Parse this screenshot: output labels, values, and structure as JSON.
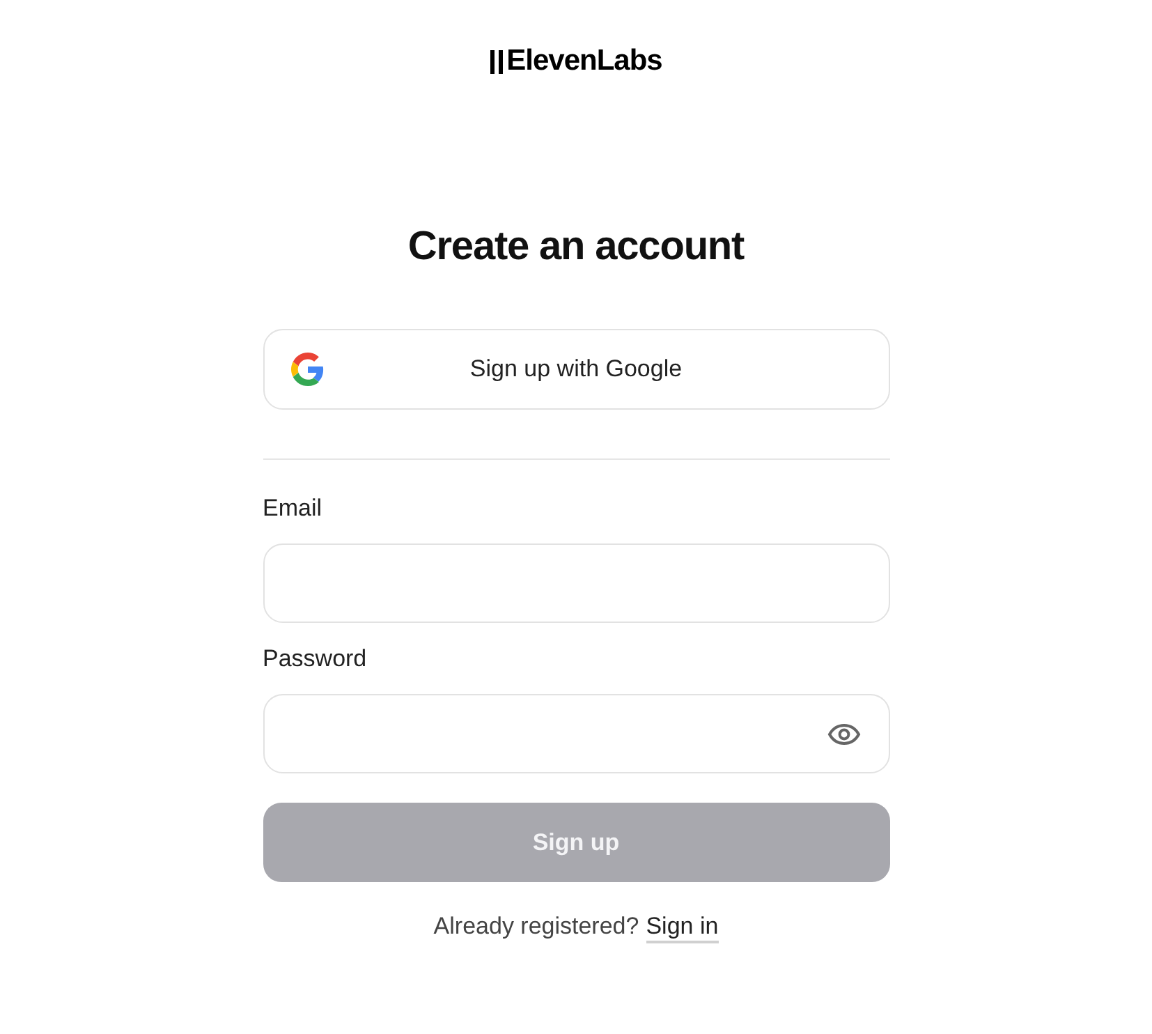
{
  "logo": {
    "text": "ElevenLabs"
  },
  "heading": "Create an account",
  "google_button": {
    "label": "Sign up with Google"
  },
  "fields": [
    {
      "label": "Email",
      "kind": "text"
    },
    {
      "label": "Password",
      "kind": "password"
    }
  ],
  "submit": {
    "label": "Sign up",
    "disabled": true
  },
  "footer": {
    "text": "Already registered?",
    "link": "Sign in"
  }
}
